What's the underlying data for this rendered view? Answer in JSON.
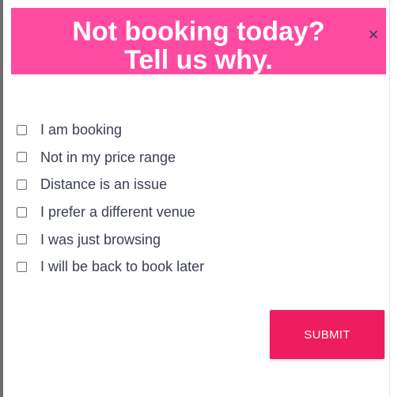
{
  "modal": {
    "title_line1": "Not booking today?",
    "title_line2": "Tell us why.",
    "close_symbol": "×",
    "close_icon": "close-icon",
    "header_color": "#ff4aa2",
    "options": [
      {
        "label": "I am booking",
        "checked": false
      },
      {
        "label": "Not in my price range",
        "checked": false
      },
      {
        "label": "Distance is an issue",
        "checked": false
      },
      {
        "label": "I prefer a different venue",
        "checked": false
      },
      {
        "label": "I was just browsing",
        "checked": false
      },
      {
        "label": "I will be back to book later",
        "checked": false
      }
    ],
    "submit_label": "SUBMIT",
    "submit_color": "#ed1c60"
  }
}
